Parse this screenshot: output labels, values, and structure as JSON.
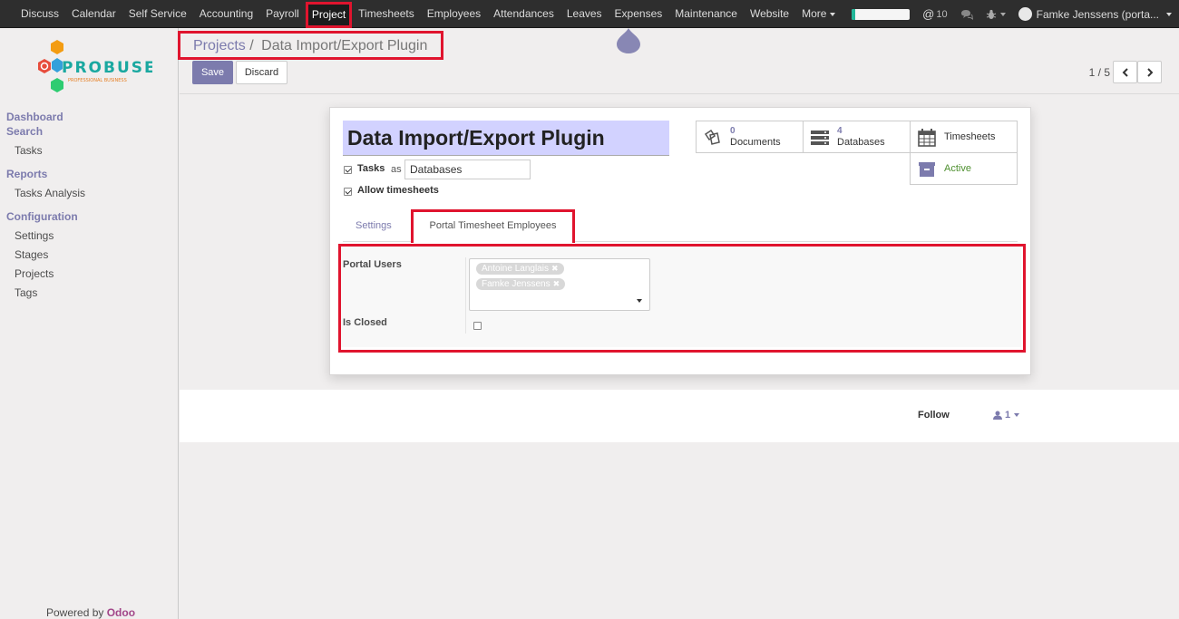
{
  "topbar": {
    "menu": [
      {
        "label": "Discuss",
        "name": "menu-discuss"
      },
      {
        "label": "Calendar",
        "name": "menu-calendar"
      },
      {
        "label": "Self Service",
        "name": "menu-self-service"
      },
      {
        "label": "Accounting",
        "name": "menu-accounting"
      },
      {
        "label": "Payroll",
        "name": "menu-payroll"
      },
      {
        "label": "Project",
        "name": "menu-project",
        "active": true
      },
      {
        "label": "Timesheets",
        "name": "menu-timesheets"
      },
      {
        "label": "Employees",
        "name": "menu-employees"
      },
      {
        "label": "Attendances",
        "name": "menu-attendances"
      },
      {
        "label": "Leaves",
        "name": "menu-leaves"
      },
      {
        "label": "Expenses",
        "name": "menu-expenses"
      },
      {
        "label": "Maintenance",
        "name": "menu-maintenance"
      },
      {
        "label": "Website",
        "name": "menu-website"
      }
    ],
    "more_label": "More",
    "messages_count": "10",
    "user_name": "Famke Jenssens (porta...",
    "progress_fraction": 0.06
  },
  "sidebar": {
    "logo_text": "PROBUSE",
    "logo_subtext": "PROFESSIONAL BUSINESS",
    "sections": {
      "dashboard": "Dashboard",
      "search": "Search",
      "tasks": "Tasks",
      "reports": "Reports",
      "tasks_analysis": "Tasks Analysis",
      "configuration": "Configuration",
      "settings": "Settings",
      "stages": "Stages",
      "projects": "Projects",
      "tags": "Tags"
    },
    "powered_by": "Powered by",
    "powered_brand": "Odoo"
  },
  "control": {
    "breadcrumb_parent": "Projects",
    "breadcrumb_sep": "/",
    "breadcrumb_current": "Data Import/Export Plugin",
    "save_label": "Save",
    "discard_label": "Discard",
    "pager": "1 / 5"
  },
  "form": {
    "title": "Data Import/Export Plugin",
    "tasks_label": "Tasks",
    "as_label": "as",
    "tasks_as_value": "Databases",
    "allow_timesheets_label": "Allow timesheets",
    "stats": {
      "documents_count": "0",
      "documents_label": "Documents",
      "databases_count": "4",
      "databases_label": "Databases",
      "timesheets_label": "Timesheets",
      "active_label": "Active"
    },
    "tabs": {
      "settings": "Settings",
      "portal": "Portal Timesheet Employees"
    },
    "portal_users_label": "Portal Users",
    "portal_users": [
      "Antoine Langlais",
      "Famke Jenssens"
    ],
    "is_closed_label": "Is Closed"
  },
  "chatter": {
    "follow_label": "Follow",
    "followers_count": "1"
  },
  "colors": {
    "accent": "#7c7bad",
    "highlight": "#e0142e",
    "topbar": "#2e2e2e",
    "active_green": "#4d8f2e"
  }
}
